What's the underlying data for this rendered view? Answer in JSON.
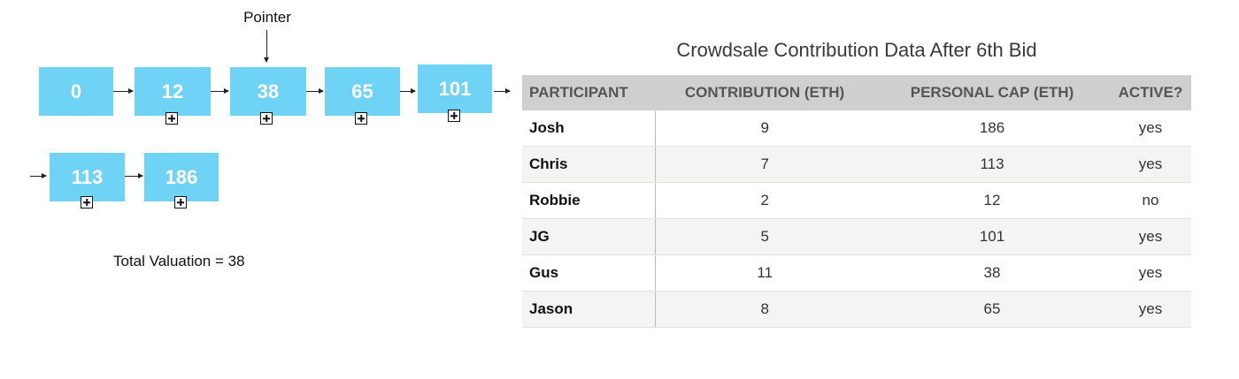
{
  "diagram": {
    "pointer_label": "Pointer",
    "total_label": "Total Valuation = 38",
    "nodes": [
      "0",
      "12",
      "38",
      "65",
      "101",
      "113",
      "186"
    ]
  },
  "table": {
    "title": "Crowdsale Contribution Data After 6th Bid",
    "headers": [
      "PARTICIPANT",
      "CONTRIBUTION (ETH)",
      "PERSONAL CAP (ETH)",
      "ACTIVE?"
    ],
    "rows": [
      [
        "Josh",
        "9",
        "186",
        "yes"
      ],
      [
        "Chris",
        "7",
        "113",
        "yes"
      ],
      [
        "Robbie",
        "2",
        "12",
        "no"
      ],
      [
        "JG",
        "5",
        "101",
        "yes"
      ],
      [
        "Gus",
        "11",
        "38",
        "yes"
      ],
      [
        "Jason",
        "8",
        "65",
        "yes"
      ]
    ]
  }
}
